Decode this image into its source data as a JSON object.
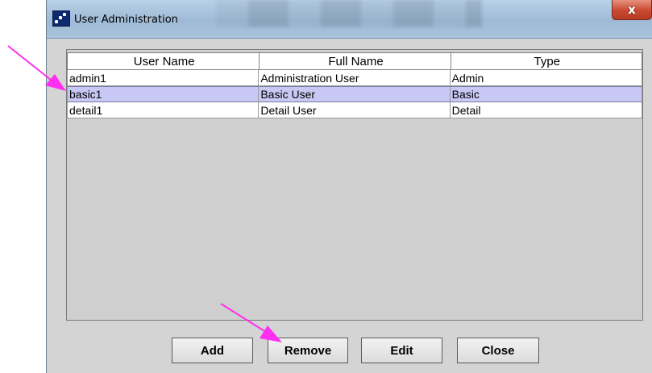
{
  "window": {
    "title": "User Administration",
    "close_glyph": "x",
    "icon": "app-icon"
  },
  "table": {
    "columns": [
      "User Name",
      "Full Name",
      "Type"
    ],
    "rows": [
      {
        "user_name": "admin1",
        "full_name": "Administration User",
        "type": "Admin",
        "selected": false
      },
      {
        "user_name": "basic1",
        "full_name": "Basic User",
        "type": "Basic",
        "selected": true
      },
      {
        "user_name": "detail1",
        "full_name": "Detail User",
        "type": "Detail",
        "selected": false
      }
    ]
  },
  "buttons": {
    "add": "Add",
    "remove": "Remove",
    "edit": "Edit",
    "close": "Close"
  },
  "colors": {
    "annotation_arrow": "#ff2ef0",
    "selection": "#c8c8f4",
    "close_button": "#c8492f"
  }
}
